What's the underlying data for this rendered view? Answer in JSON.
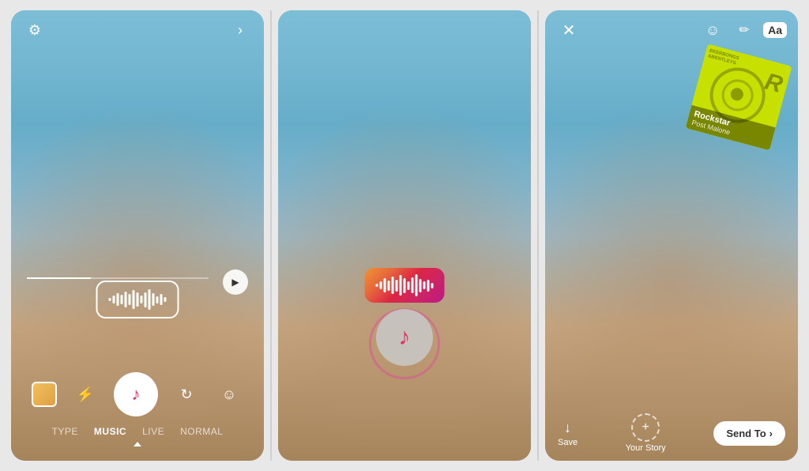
{
  "panels": [
    {
      "id": "panel1",
      "type": "camera_music",
      "top_bar": {
        "left_icon": "gear",
        "right_icon": "chevron-right"
      },
      "waveform": {
        "style": "outlined",
        "bars": [
          3,
          8,
          14,
          10,
          18,
          12,
          20,
          15,
          9,
          16,
          22,
          14,
          8,
          12,
          6
        ]
      },
      "play_button": "▶",
      "toolbar": {
        "icons": [
          "gallery",
          "bolt",
          "music",
          "refresh",
          "face"
        ],
        "active": "music"
      },
      "tabs": [
        "TYPE",
        "MUSIC",
        "LIVE",
        "NORMAL"
      ],
      "active_tab": "MUSIC"
    },
    {
      "id": "panel2",
      "type": "music_playing",
      "waveform": {
        "style": "gradient",
        "bars": [
          4,
          9,
          16,
          11,
          20,
          13,
          22,
          17,
          10,
          18,
          24,
          15,
          9,
          13,
          7
        ]
      },
      "music_note": "♪"
    },
    {
      "id": "panel3",
      "type": "share",
      "top_bar": {
        "left_icon": "close",
        "right_icons": [
          "face-sticker",
          "pencil",
          "Aa"
        ]
      },
      "album": {
        "title": "Rockstar",
        "artist": "Post Malone",
        "cover_color": "#c8e000"
      },
      "bottom_bar": {
        "save_label": "Save",
        "save_icon": "↓",
        "your_story_label": "Your Story",
        "send_to_label": "Send To",
        "send_to_icon": "›"
      }
    }
  ]
}
